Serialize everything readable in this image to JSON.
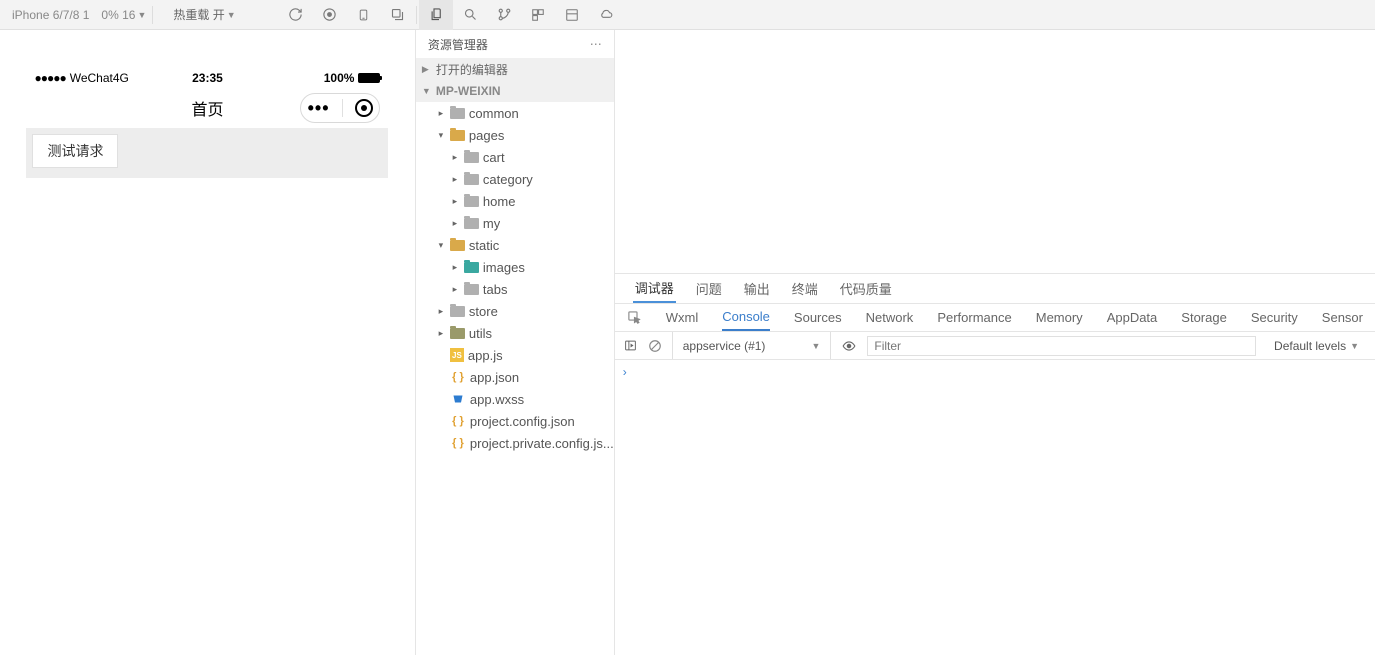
{
  "toolbar": {
    "device": "iPhone 6/7/8 1",
    "zoom": "0% 16",
    "hotReload": "热重载 开"
  },
  "simulator": {
    "carrier": "WeChat4G",
    "time": "23:35",
    "battery": "100%",
    "navTitle": "首页",
    "buttonLabel": "测试请求"
  },
  "explorer": {
    "title": "资源管理器",
    "sections": {
      "openEditors": "打开的编辑器",
      "project": "MP-WEIXIN"
    },
    "tree": [
      {
        "label": "common",
        "type": "folder",
        "depth": 1,
        "open": false
      },
      {
        "label": "pages",
        "type": "folder-open",
        "depth": 1,
        "open": true
      },
      {
        "label": "cart",
        "type": "folder",
        "depth": 2,
        "open": false
      },
      {
        "label": "category",
        "type": "folder",
        "depth": 2,
        "open": false
      },
      {
        "label": "home",
        "type": "folder",
        "depth": 2,
        "open": false
      },
      {
        "label": "my",
        "type": "folder",
        "depth": 2,
        "open": false
      },
      {
        "label": "static",
        "type": "folder-open",
        "depth": 1,
        "open": true
      },
      {
        "label": "images",
        "type": "folder-teal",
        "depth": 2,
        "open": false
      },
      {
        "label": "tabs",
        "type": "folder",
        "depth": 2,
        "open": false
      },
      {
        "label": "store",
        "type": "folder",
        "depth": 1,
        "open": false
      },
      {
        "label": "utils",
        "type": "folder-olive",
        "depth": 1,
        "open": false
      },
      {
        "label": "app.js",
        "type": "js",
        "depth": 1
      },
      {
        "label": "app.json",
        "type": "json",
        "depth": 1
      },
      {
        "label": "app.wxss",
        "type": "wxss",
        "depth": 1
      },
      {
        "label": "project.config.json",
        "type": "json",
        "depth": 1
      },
      {
        "label": "project.private.config.js...",
        "type": "json",
        "depth": 1
      }
    ]
  },
  "debugger": {
    "tabs": [
      "调试器",
      "问题",
      "输出",
      "终端",
      "代码质量"
    ],
    "activeTab": "调试器",
    "devtoolsTabs": [
      "Wxml",
      "Console",
      "Sources",
      "Network",
      "Performance",
      "Memory",
      "AppData",
      "Storage",
      "Security",
      "Sensor"
    ],
    "activeDevtoolsTab": "Console",
    "context": "appservice (#1)",
    "filterPlaceholder": "Filter",
    "levels": "Default levels"
  }
}
